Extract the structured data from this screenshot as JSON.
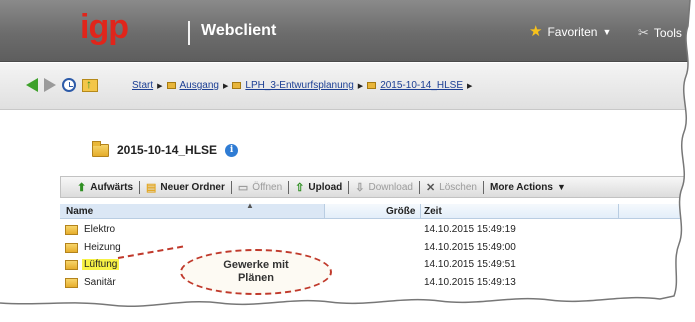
{
  "header": {
    "logo": "igp",
    "app_title": "Webclient",
    "favorites_label": "Favoriten",
    "tools_label": "Tools"
  },
  "breadcrumb": {
    "items": [
      {
        "label": "Start"
      },
      {
        "label": "Ausgang"
      },
      {
        "label": "LPH_3-Entwurfsplanung"
      },
      {
        "label": "2015-10-14_HLSE"
      }
    ]
  },
  "folder": {
    "title": "2015-10-14_HLSE",
    "info_glyph": "i"
  },
  "toolbar": {
    "up_label": "Aufwärts",
    "new_folder_label": "Neuer Ordner",
    "open_label": "Öffnen",
    "upload_label": "Upload",
    "download_label": "Download",
    "delete_label": "Löschen",
    "more_label": "More Actions"
  },
  "table": {
    "columns": {
      "name": "Name",
      "size": "Größe",
      "time": "Zeit"
    },
    "rows": [
      {
        "name": "Elektro",
        "time": "14.10.2015 15:49:19"
      },
      {
        "name": "Heizung",
        "time": "14.10.2015 15:49:00"
      },
      {
        "name": "Lüftung",
        "time": "14.10.2015 15:49:51"
      },
      {
        "name": "Sanitär",
        "time": "14.10.2015 15:49:13"
      }
    ]
  },
  "callout": {
    "line1": "Gewerke mit",
    "line2": "Plänen"
  },
  "colors": {
    "logo": "#e0251b",
    "highlight": "#f7f246",
    "callout_border": "#c0392b",
    "link": "#1c3f94"
  }
}
